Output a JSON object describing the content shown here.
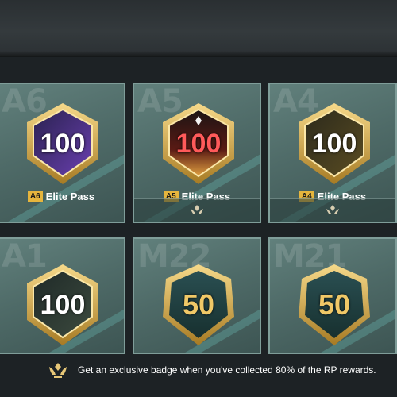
{
  "cards": [
    {
      "tier": "A6",
      "number": "100",
      "pass_label": "Elite Pass",
      "variant": "purple",
      "has_footer": false
    },
    {
      "tier": "A5",
      "number": "100",
      "pass_label": "Elite Pass",
      "variant": "red",
      "has_footer": true
    },
    {
      "tier": "A4",
      "number": "100",
      "pass_label": "Elite Pass",
      "variant": "gold",
      "has_footer": true
    },
    {
      "tier": "A1",
      "number": "100",
      "variant": "dark"
    },
    {
      "tier": "M22",
      "number": "50",
      "variant": "teal"
    },
    {
      "tier": "M21",
      "number": "50",
      "variant": "teal"
    }
  ],
  "footer": {
    "message": "Get an exclusive badge when you've collected 80% of the RP rewards."
  },
  "colors": {
    "card_bg": "#4f6b68",
    "card_border": "#7f9d99",
    "gold": "#e6b53d",
    "text": "#ffffff"
  }
}
